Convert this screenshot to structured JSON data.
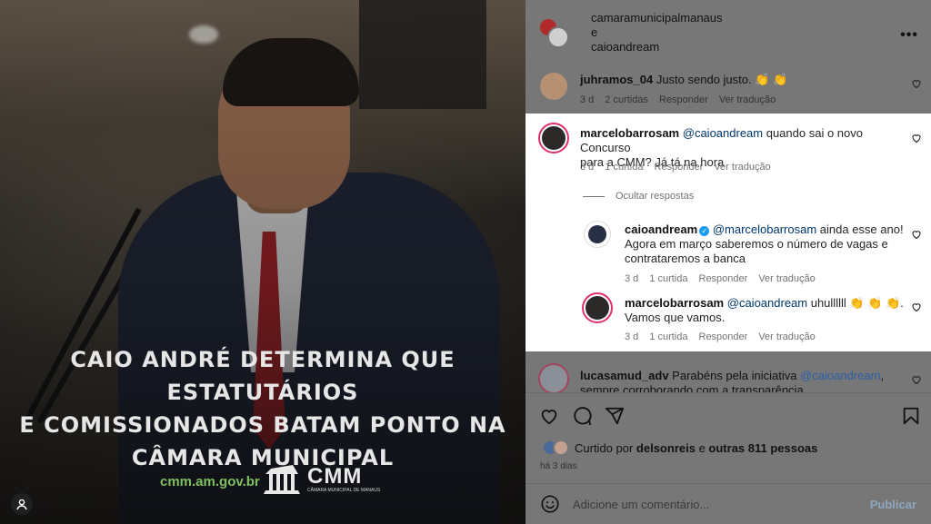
{
  "post": {
    "headline_lines": [
      "CAIO ANDRÉ DETERMINA QUE ESTATUTÁRIOS",
      "E COMISSIONADOS BATAM PONTO NA",
      "CÂMARA MUNICIPAL"
    ],
    "footer_url": "cmm.am.gov.br",
    "logo_text": "CMM",
    "logo_subtext": "CÂMARA MUNICIPAL DE MANAUS"
  },
  "header": {
    "user1": "camaramunicipalmanaus",
    "joiner": "e",
    "user2": "caioandream",
    "more_label": "•••"
  },
  "comments": [
    {
      "user": "juhramos_04",
      "text": "Justo sendo justo. 👏 👏",
      "age": "3 d",
      "likes": "2 curtidas",
      "reply": "Responder",
      "translate": "Ver tradução"
    },
    {
      "user": "marcelobarrosam",
      "mention": "@caioandream",
      "text_line1": " quando sai o novo Concurso",
      "text_line2": "para a CMM? Já tá na hora",
      "age": "3 d",
      "likes": "1 curtida",
      "reply": "Responder",
      "translate": "Ver tradução"
    },
    {
      "user": "caioandream",
      "mention": "@marcelobarrosam",
      "text_line1": " ainda esse ano!",
      "text_line2": "Agora em março saberemos o número de vagas e",
      "text_line3": "contrataremos a banca",
      "age": "3 d",
      "likes": "1 curtida",
      "reply": "Responder",
      "translate": "Ver tradução"
    },
    {
      "user": "marcelobarrosam",
      "mention": "@caioandream",
      "text_line1": " uhullllll 👏 👏 👏.",
      "text_line2": "Vamos que vamos.",
      "age": "3 d",
      "likes": "1 curtida",
      "reply": "Responder",
      "translate": "Ver tradução"
    },
    {
      "user": "lucasamud_adv",
      "text": "Parabéns pela iniciativa ",
      "mention": "@caioandream",
      "text_end": ",",
      "text_line2": "sempre corroborando com a transparência"
    }
  ],
  "hide_replies": "Ocultar respostas",
  "likes_summary": {
    "prefix": "Curtido por ",
    "user": "delsonreis",
    "middle": " e ",
    "others": "outras 811 pessoas"
  },
  "date": "há 3 dias",
  "comment_input": {
    "placeholder": "Adicione um comentário...",
    "publish": "Publicar"
  },
  "icons": [
    "heart-icon",
    "comment-icon",
    "share-icon",
    "bookmark-icon",
    "emoji-icon",
    "more-icon",
    "verified-icon",
    "tag-user-icon"
  ],
  "colors": {
    "link": "#00376b",
    "highlight_bg": "#ffffff",
    "dim_bg": "#777777",
    "url_green": "#7dc060",
    "story_ring": "#e1306c"
  }
}
